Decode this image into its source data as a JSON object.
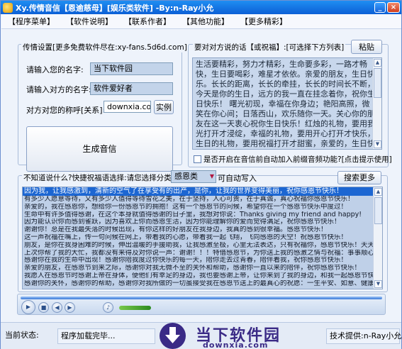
{
  "window": {
    "title": "Xy.传情音信【恩逾慈母】[娱乐类软件]  -By:n-Ray小允"
  },
  "menu": [
    "【程序菜单】",
    "【软件说明】",
    "【联系作者】",
    "【其他功能】",
    "【更多精彩】"
  ],
  "send_panel": {
    "title": "传情设置[更多免费软件尽在:xy-fans.5d6d.com]",
    "name_label": "请输入您的名字:",
    "name_value": "当下软件园",
    "other_name_label": "请输入对方的名字:",
    "other_name_value": "软件爱好者",
    "honorific_label": "对方对您的称呼[关系]:",
    "honorific_value": "downxia.com",
    "example_button": "实例",
    "generate_button": "生成音信"
  },
  "message_panel": {
    "title": "要对对方说的话【或祝福】:[可选择下方列表]",
    "paste_button": "粘贴",
    "text": "    生活要精彩，努力才精彩，生命要多彩，一路才畅快，生日要喝彩，难星才依依。亲爱的朋友，生日快乐。长长的距离，长长的牵挂，长长的时间长不断，今天是你的生日，远方的我一直在挂念着你，祝你生日快乐！    曙光初现，幸福在你身边；艳阳高照，微笑在你心间；日落西山，欢乐随你一天。关心你的朋友在这一天衷心祝你生日快乐！红烛的礼物，要用我光打开才浸绽，幸福的礼物，要用开心打开才快乐，生日的礼物，要用祝福打开才甜蜜，亲爱的，生日快乐，盈盈今日天如水，恋恋当年水似天。情缘悠我心，相思比梦长。祝福你生日快乐！生命中的每一天永远青春靓丽！",
    "auto_music_label": "是否开启在音信前自动加入前缀音频功能?[点击提示使用]"
  },
  "list_panel": {
    "prompt": "不知道说什么?快捷祝福语选择:请您选择分类:",
    "category_value": "感恩类",
    "auto_write_label": "可自动写入",
    "search_button": "搜索更多",
    "lines": [
      "因为我，让我感激到，清新的空气了在享受有的出产，是你，让我的世界变得美丽，祝你感恩节快乐！",
      "有多少人愿意等待，又有多少人值得等待雪花之美，在于坚持，人心可贵，在于真诚，真心祝福你感恩节快乐！",
      "亲爱的，我在感恩你，想给你一份感恩节的拥抱！这有一个感恩节的问候，希望你在一个感恩节快乐中度过！",
      "生命中有许多值得感谢，在这个本身就值得感谢的日子里，我想对你说：Thanks giving my friend and happy!",
      "因为能认识你而感到雀跃，因为喜欢上你而感恩生活，因为你能理解你的爱而觉得满足，祝你感恩节快乐！",
      "谢谢你！总是在我最失落的时候出现，有你这样的好朋友在我身边，我真的感到很幸福。感恩节快乐！",
      "这一声祝福在嘴上，传一句问候在网上，带着我的心愿，带着我一起飞翔，飞向感恩的天空！祝感恩节快乐！",
      "朋友，是你在我身困难的时候，伸出温暖的手援助我，让我感激至极，心里无法表达，只有祝福你，感恩节快乐！天天",
      "上次你帮了我的大忙，我都没有来得及对你说一声：谢谢！！！特借感恩节，为你送上我的感激之情与祝福：事事顺心！",
      "感谢你在我的生命中出现！感谢你陪我度过你快乐的每一天，陪你走去过青春，陪伴着我，祝你感恩节快乐！",
      "亲爱的朋友，在感恩节到来之际，感谢你对我无微不至的关怀和帮助，感谢你一直以来的陪伴，祝你感恩节快乐！",
      "我愿人在感恩节时感谢上帝在身体，便他们有幸足的身边，我也要感谢上帝，让你来到了我的身边，和我一起感恩节快乐！",
      "感谢你的关怀，感谢你的帮助，感谢你对我所做的一切虽接受我在感恩节送上的最真心的祝愿：一生平安、如意、健康！"
    ]
  },
  "status": {
    "state_label": "当前状态:",
    "state_value": "程序加载完毕...",
    "support_label": "技术提供:n-Ray小允"
  },
  "watermark": {
    "title": "当下软件园",
    "subtitle": "downxia.com"
  },
  "colors": {
    "titlebar": "#0c5fd6",
    "selection": "#1c66d2",
    "field_fill": "#c3d4ea",
    "watermark": "#3a2a86"
  }
}
